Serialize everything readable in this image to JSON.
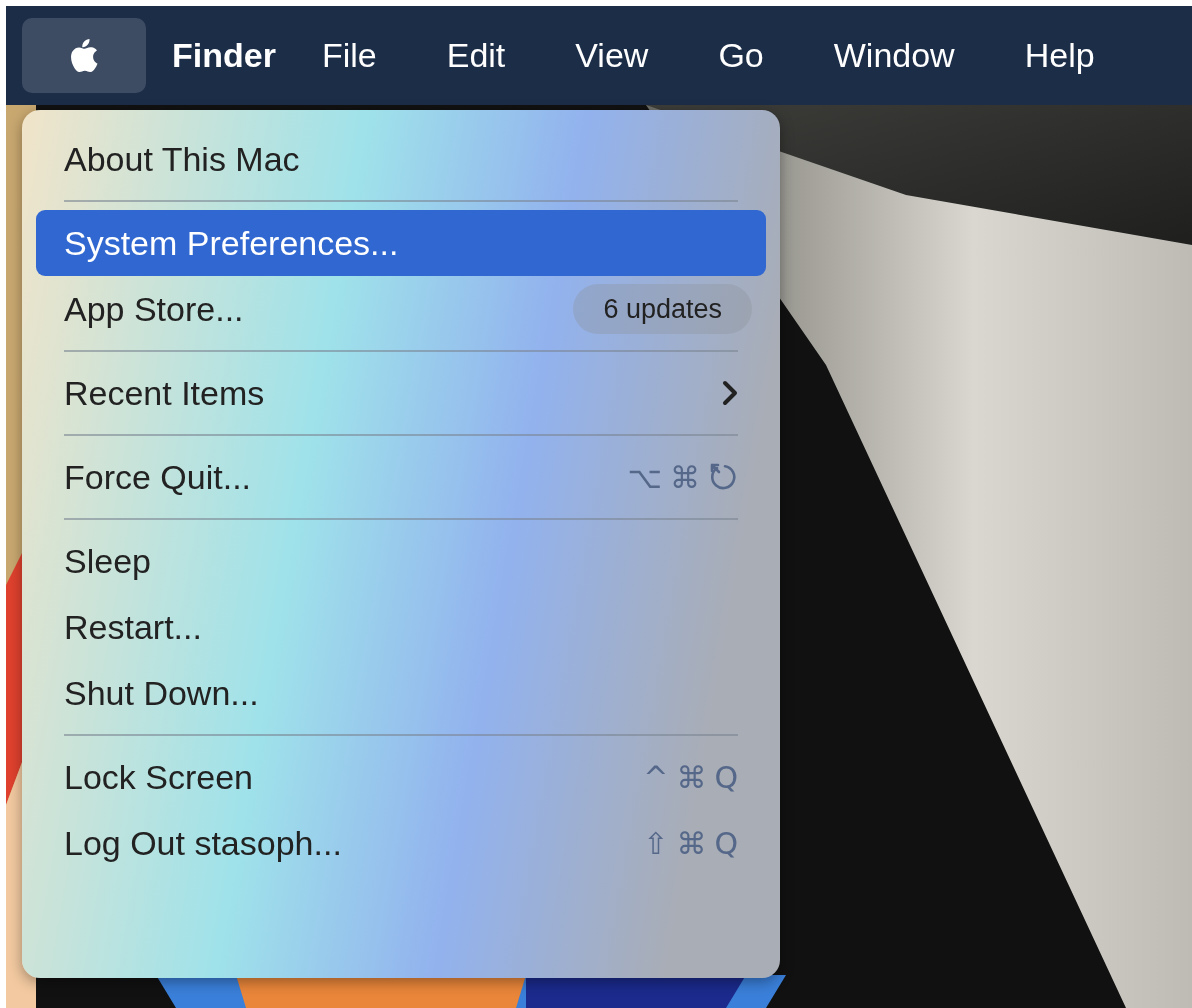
{
  "menu_bar": [
    {
      "kind": "apple",
      "selected": true
    },
    {
      "kind": "app",
      "label": "Finder",
      "selected": false
    },
    {
      "kind": "menu",
      "label": "File",
      "selected": false
    },
    {
      "kind": "menu",
      "label": "Edit",
      "selected": false
    },
    {
      "kind": "menu",
      "label": "View",
      "selected": false
    },
    {
      "kind": "menu",
      "label": "Go",
      "selected": false
    },
    {
      "kind": "menu",
      "label": "Window",
      "selected": false
    },
    {
      "kind": "menu",
      "label": "Help",
      "selected": false
    }
  ],
  "apple_menu": {
    "sections": [
      [
        {
          "kind": "plain",
          "label": "About This Mac",
          "selected": false
        }
      ],
      [
        {
          "kind": "plain",
          "label": "System Preferences...",
          "selected": true
        },
        {
          "kind": "badge",
          "label": "App Store...",
          "badge": "6 updates",
          "selected": false
        }
      ],
      [
        {
          "kind": "submenu",
          "label": "Recent Items",
          "selected": false
        }
      ],
      [
        {
          "kind": "shortcut_icon",
          "label": "Force Quit...",
          "keys": [
            "⌥",
            "⌘"
          ],
          "selected": false
        }
      ],
      [
        {
          "kind": "plain",
          "label": "Sleep",
          "selected": false
        },
        {
          "kind": "plain",
          "label": "Restart...",
          "selected": false
        },
        {
          "kind": "plain",
          "label": "Shut Down...",
          "selected": false
        }
      ],
      [
        {
          "kind": "shortcut",
          "label": "Lock Screen",
          "keys": [
            "^",
            "⌘",
            "Q"
          ],
          "selected": false
        },
        {
          "kind": "shortcut",
          "label": "Log Out stasoph...",
          "keys": [
            "⇧",
            "⌘",
            "Q"
          ],
          "selected": false
        }
      ]
    ]
  }
}
